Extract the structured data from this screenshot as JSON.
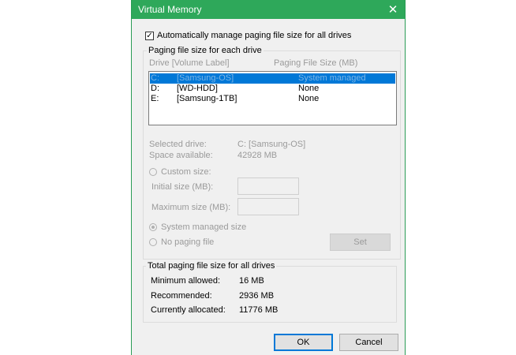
{
  "window": {
    "title": "Virtual Memory",
    "close_glyph": "✕"
  },
  "auto_manage": {
    "label": "Automatically manage paging file size for all drives",
    "checked": true
  },
  "drive_group": {
    "legend": "Paging file size for each drive",
    "col_drive": "Drive  [Volume Label]",
    "col_size": "Paging File Size (MB)",
    "rows": [
      {
        "drive": "C:",
        "label": "[Samsung-OS]",
        "size": "System managed",
        "selected": true
      },
      {
        "drive": "D:",
        "label": "[WD-HDD]",
        "size": "None",
        "selected": false
      },
      {
        "drive": "E:",
        "label": "[Samsung-1TB]",
        "size": "None",
        "selected": false
      }
    ],
    "selected_drive_label": "Selected drive:",
    "selected_drive_value": "C:  [Samsung-OS]",
    "space_available_label": "Space available:",
    "space_available_value": "42928 MB",
    "custom_size_label": "Custom size:",
    "initial_size_label": "Initial size (MB):",
    "maximum_size_label": "Maximum size (MB):",
    "system_managed_label": "System managed size",
    "no_paging_label": "No paging file",
    "set_label": "Set"
  },
  "total_group": {
    "legend": "Total paging file size for all drives",
    "minimum_label": "Minimum allowed:",
    "minimum_value": "16 MB",
    "recommended_label": "Recommended:",
    "recommended_value": "2936 MB",
    "allocated_label": "Currently allocated:",
    "allocated_value": "11776 MB"
  },
  "buttons": {
    "ok": "OK",
    "cancel": "Cancel"
  },
  "colors": {
    "titlebar": "#2ea85a",
    "selection": "#0078d7"
  }
}
